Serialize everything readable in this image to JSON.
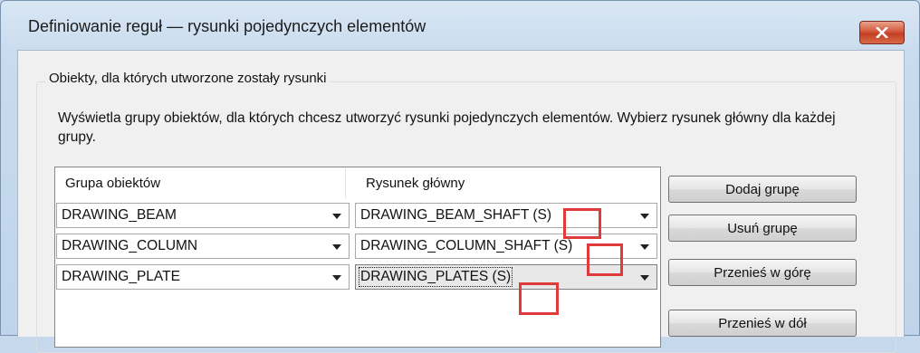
{
  "window": {
    "title": "Definiowanie reguł — rysunki pojedynczych elementów",
    "close_icon": "close-icon"
  },
  "group": {
    "label": "Obiekty, dla których utworzone zostały rysunki",
    "description": "Wyświetla grupy obiektów, dla których chcesz utworzyć rysunki pojedynczych elementów. Wybierz rysunek główny dla każdej grupy."
  },
  "table": {
    "columns": [
      "Grupa obiektów",
      "Rysunek główny"
    ],
    "rows": [
      {
        "group": "DRAWING_BEAM",
        "drawing": "DRAWING_BEAM_SHAFT (S)"
      },
      {
        "group": "DRAWING_COLUMN",
        "drawing": "DRAWING_COLUMN_SHAFT (S)"
      },
      {
        "group": "DRAWING_PLATE",
        "drawing": "DRAWING_PLATES (S)"
      }
    ]
  },
  "buttons": {
    "add": "Dodaj grupę",
    "remove": "Usuń grupę",
    "move_up": "Przenieś w górę",
    "move_down": "Przenieś w dół"
  },
  "colors": {
    "highlight": "#e03a3a",
    "close_button": "#c43e24"
  }
}
